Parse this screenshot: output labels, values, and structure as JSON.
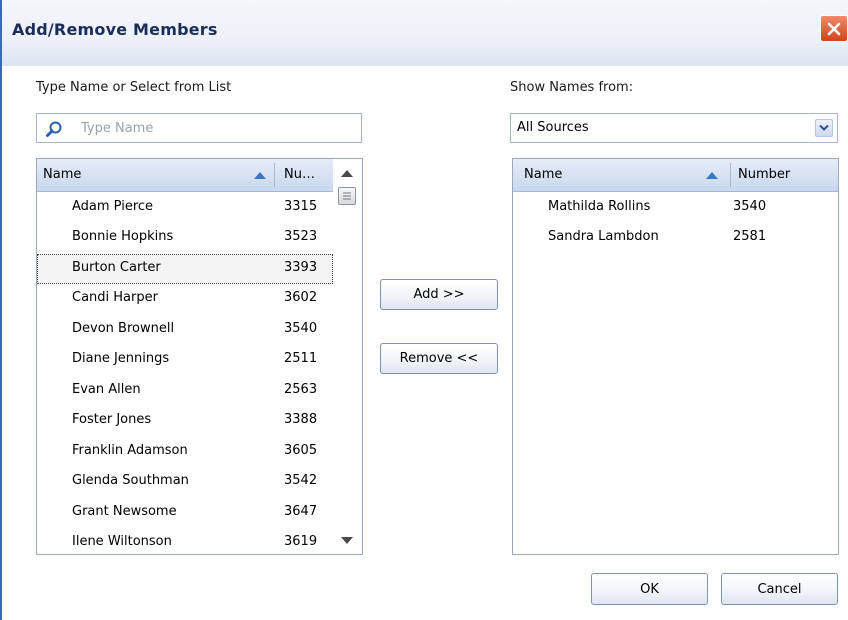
{
  "window": {
    "title": "Add/Remove Members"
  },
  "left": {
    "label": "Type Name or Select from List",
    "search_placeholder": "Type Name",
    "search_value": "",
    "col_name": "Name",
    "col_number": "Nu…",
    "rows": [
      {
        "name": "Adam Pierce",
        "number": "3315"
      },
      {
        "name": "Bonnie Hopkins",
        "number": "3523"
      },
      {
        "name": "Burton Carter",
        "number": "3393"
      },
      {
        "name": "Candi Harper",
        "number": "3602"
      },
      {
        "name": "Devon Brownell",
        "number": "3540"
      },
      {
        "name": "Diane Jennings",
        "number": "2511"
      },
      {
        "name": "Evan Allen",
        "number": "2563"
      },
      {
        "name": "Foster Jones",
        "number": "3388"
      },
      {
        "name": "Franklin Adamson",
        "number": "3605"
      },
      {
        "name": "Glenda Southman",
        "number": "3542"
      },
      {
        "name": "Grant Newsome",
        "number": "3647"
      },
      {
        "name": "Ilene Wiltonson",
        "number": "3619"
      }
    ]
  },
  "right": {
    "label": "Show Names from:",
    "source_selected": "All Sources",
    "col_name": "Name",
    "col_number": "Number",
    "rows": [
      {
        "name": "Mathilda Rollins",
        "number": "3540"
      },
      {
        "name": "Sandra Lambdon",
        "number": "2581"
      }
    ]
  },
  "buttons": {
    "add": "Add >>",
    "remove": "Remove <<",
    "ok": "OK",
    "cancel": "Cancel"
  },
  "icons": {
    "close": "close-icon",
    "search": "magnifier-icon",
    "dropdown": "chevron-down-icon",
    "sort": "sort-ascending-icon",
    "scroll_up": "scroll-up-arrow-icon",
    "scroll_down": "scroll-down-arrow-icon"
  },
  "colors": {
    "title_text": "#1a2e5c",
    "close_button": "#d2431c",
    "header_bg": "#c8d7ee",
    "sort_arrow": "#3a78c9"
  }
}
